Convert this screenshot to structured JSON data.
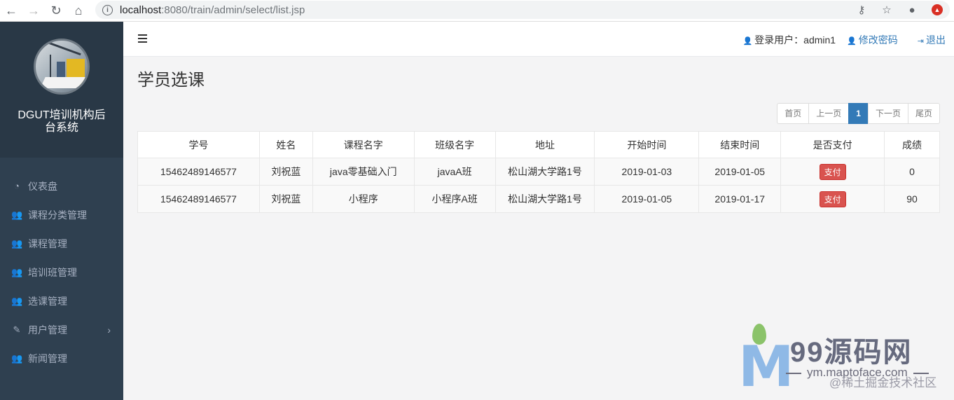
{
  "browser": {
    "url_host": "localhost",
    "url_rest": ":8080/train/admin/select/list.jsp"
  },
  "sidebar": {
    "brand": "DGUT培训机构后台系统",
    "items": [
      {
        "label": "仪表盘",
        "icon": "dashboard-icon",
        "glyph": "◔"
      },
      {
        "label": "课程分类管理",
        "icon": "users-icon",
        "glyph": "👥"
      },
      {
        "label": "课程管理",
        "icon": "users-icon",
        "glyph": "👥"
      },
      {
        "label": "培训班管理",
        "icon": "users-icon",
        "glyph": "👥"
      },
      {
        "label": "选课管理",
        "icon": "users-icon",
        "glyph": "👥"
      },
      {
        "label": "用户管理",
        "icon": "pin-icon",
        "glyph": "✎"
      },
      {
        "label": "新闻管理",
        "icon": "users-icon",
        "glyph": "👥"
      }
    ]
  },
  "topbar": {
    "login_label": "登录用户：admin1",
    "change_password": "修改密码",
    "logout": "退出"
  },
  "main": {
    "title": "学员选课",
    "pager": {
      "first": "首页",
      "prev": "上一页",
      "current": "1",
      "next": "下一页",
      "last": "尾页"
    },
    "table": {
      "headers": [
        "学号",
        "姓名",
        "课程名字",
        "班级名字",
        "地址",
        "开始时间",
        "结束时间",
        "是否支付",
        "成绩"
      ],
      "rows": [
        [
          "15462489146577",
          "刘祝蓝",
          "java零基础入门",
          "javaA班",
          "松山湖大学路1号",
          "2019-01-03",
          "2019-01-05",
          "支付",
          "0"
        ],
        [
          "15462489146577",
          "刘祝蓝",
          "小程序",
          "小程序A班",
          "松山湖大学路1号",
          "2019-01-05",
          "2019-01-17",
          "支付",
          "90"
        ]
      ]
    }
  },
  "watermark": {
    "title": "99源码网",
    "url": "ym.maptoface.com",
    "community": "@稀土掘金技术社区"
  },
  "colors": {
    "sidebar_bg": "#2f4050",
    "accent": "#337ab7",
    "danger": "#d9534f"
  }
}
